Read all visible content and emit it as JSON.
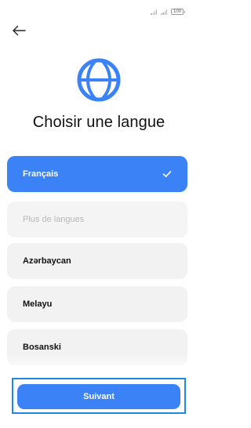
{
  "status_bar": {
    "battery": "100",
    "icons": [
      "signal-icon",
      "signal-icon",
      "battery-icon"
    ]
  },
  "header": {
    "back_icon": "arrow-left-icon"
  },
  "hero": {
    "icon": "globe-icon",
    "title": "Choisir une langue"
  },
  "languages": [
    {
      "label": "Français",
      "selected": true
    },
    {
      "label": "Plus de langues",
      "muted": true
    },
    {
      "label": "Azərbaycan"
    },
    {
      "label": "Melayu"
    },
    {
      "label": "Bosanski"
    }
  ],
  "footer": {
    "next_label": "Suivant"
  },
  "colors": {
    "accent": "#3b82f6",
    "highlight_border": "#1e88e5",
    "item_bg": "#f2f2f2"
  }
}
